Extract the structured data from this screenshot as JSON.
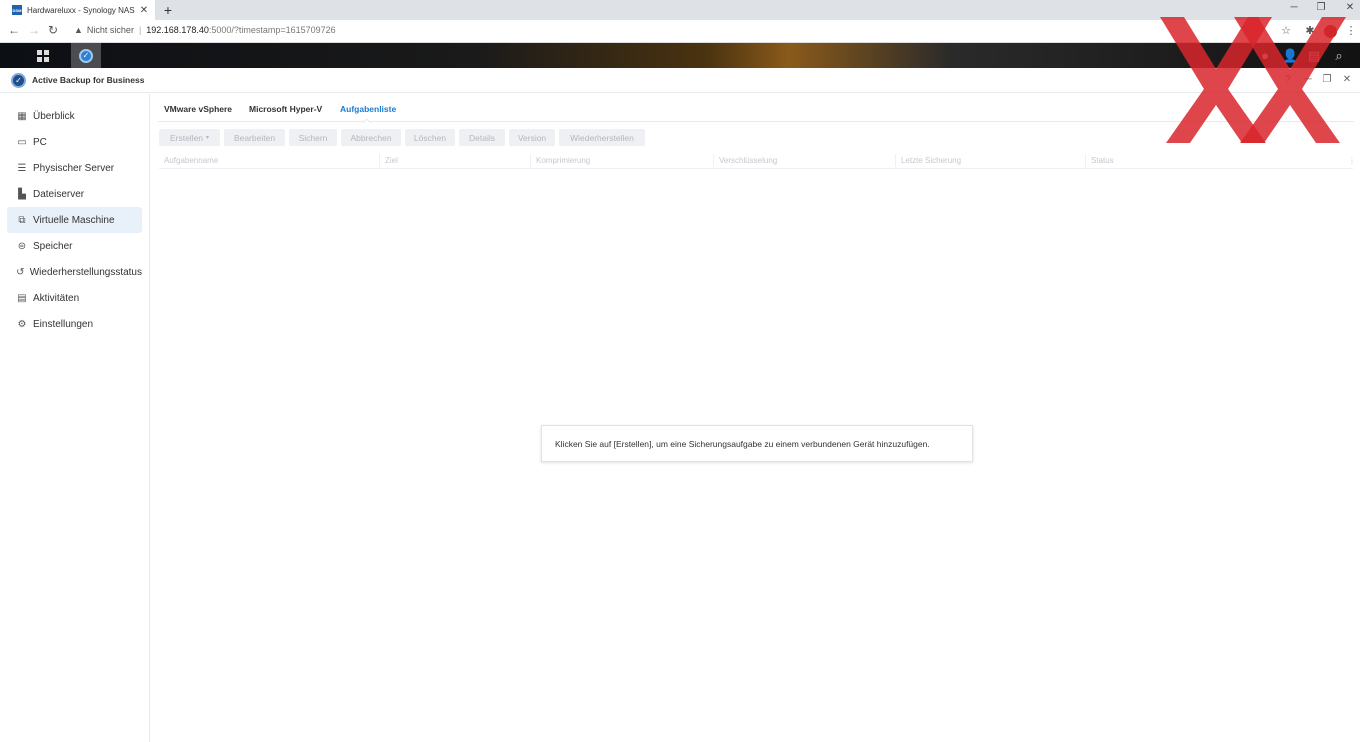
{
  "browser": {
    "tab_title": "Hardwareluxx - Synology NAS",
    "favicon_text": "DSM",
    "address_warning": "Nicht sicher",
    "url_host": "192.168.178.40",
    "url_path": ":5000/?timestamp=1615709726"
  },
  "app": {
    "title": "Active Backup for Business"
  },
  "sidebar": {
    "items": [
      {
        "label": "Überblick",
        "icon": "overview-icon"
      },
      {
        "label": "PC",
        "icon": "monitor-icon"
      },
      {
        "label": "Physischer Server",
        "icon": "server-icon"
      },
      {
        "label": "Dateiserver",
        "icon": "file-server-icon"
      },
      {
        "label": "Virtuelle Maschine",
        "icon": "virtual-machine-icon"
      },
      {
        "label": "Speicher",
        "icon": "storage-icon"
      },
      {
        "label": "Wiederherstellungsstatus",
        "icon": "restore-icon"
      },
      {
        "label": "Aktivitäten",
        "icon": "log-icon"
      },
      {
        "label": "Einstellungen",
        "icon": "gear-icon"
      }
    ],
    "selected": "Virtuelle Maschine"
  },
  "tabs": [
    "VMware vSphere",
    "Microsoft Hyper-V",
    "Aufgabenliste"
  ],
  "active_tab": "Aufgabenliste",
  "toolbar": {
    "create": "Erstellen",
    "edit": "Bearbeiten",
    "backup": "Sichern",
    "cancel": "Abbrechen",
    "delete": "Löschen",
    "details": "Details",
    "version": "Version",
    "restore": "Wiederherstellen"
  },
  "table": {
    "columns": [
      "Aufgabenname",
      "Ziel",
      "Komprimierung",
      "Verschlüsselung",
      "Letzte Sicherung",
      "Status"
    ]
  },
  "empty_hint": "Klicken Sie auf [Erstellen], um eine Sicherungsaufgabe zu einem verbundenen Gerät hinzuzufügen.",
  "colors": {
    "accent": "#1a7bd1",
    "selected_bg": "#e8f0fa",
    "watermark": "#d9262c"
  }
}
